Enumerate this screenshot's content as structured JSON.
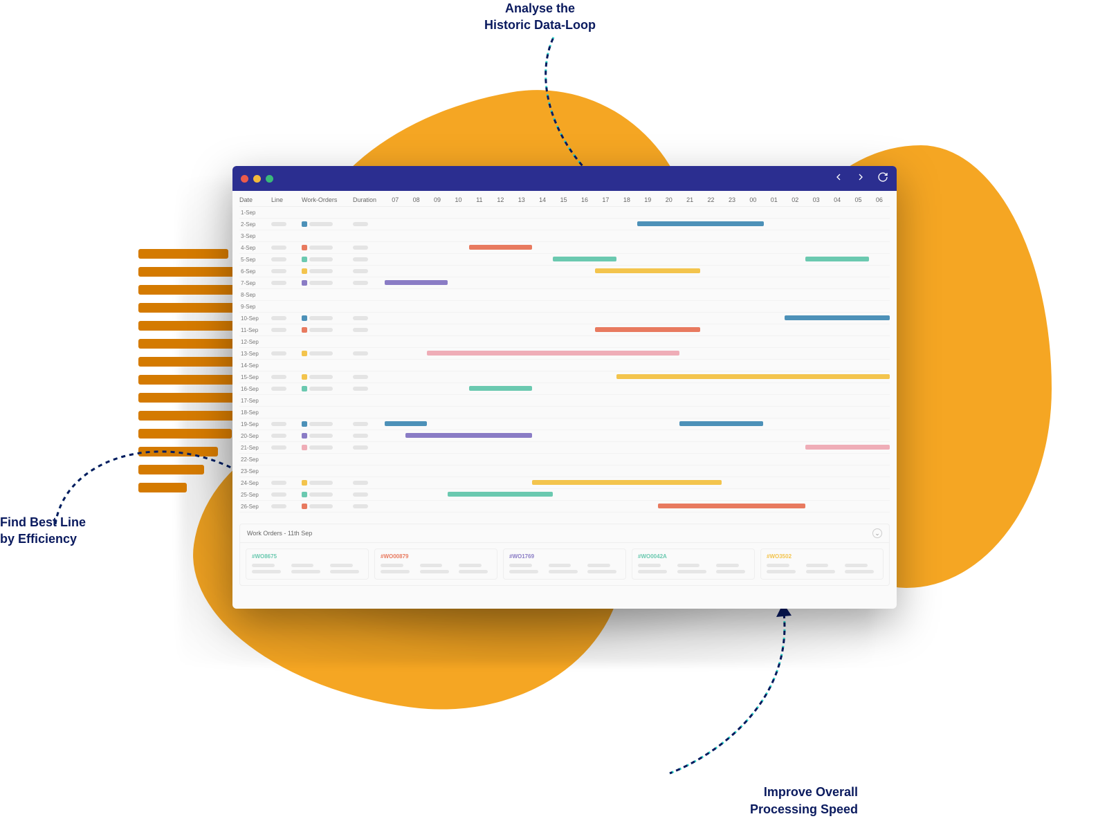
{
  "callouts": {
    "top_line1": "Analyse the",
    "top_line2": "Historic Data-Loop",
    "left_line1": "Find Best Line",
    "left_line2": "by Efficiency",
    "bottom_line1": "Improve Overall",
    "bottom_line2": "Processing Speed"
  },
  "columns": {
    "date": "Date",
    "line": "Line",
    "wo": "Work-Orders",
    "duration": "Duration"
  },
  "hours": [
    "07",
    "08",
    "09",
    "10",
    "11",
    "12",
    "13",
    "14",
    "15",
    "16",
    "17",
    "18",
    "19",
    "20",
    "21",
    "22",
    "23",
    "00",
    "01",
    "02",
    "03",
    "04",
    "05",
    "06"
  ],
  "rows": [
    {
      "date": "1-Sep",
      "line": false,
      "wo": false,
      "dur": false,
      "bars": []
    },
    {
      "date": "2-Sep",
      "line": true,
      "wo": "c-blue",
      "dur": true,
      "bars": [
        {
          "c": "c-blue",
          "start": 12,
          "span": 6
        }
      ]
    },
    {
      "date": "3-Sep",
      "line": false,
      "wo": false,
      "dur": false,
      "bars": []
    },
    {
      "date": "4-Sep",
      "line": true,
      "wo": "c-red",
      "dur": true,
      "bars": [
        {
          "c": "c-red",
          "start": 4,
          "span": 3
        }
      ]
    },
    {
      "date": "5-Sep",
      "line": true,
      "wo": "c-teal",
      "dur": true,
      "bars": [
        {
          "c": "c-teal",
          "start": 8,
          "span": 3
        },
        {
          "c": "c-teal",
          "start": 20,
          "span": 3
        }
      ]
    },
    {
      "date": "6-Sep",
      "line": true,
      "wo": "c-amber",
      "dur": true,
      "bars": [
        {
          "c": "c-amber",
          "start": 10,
          "span": 5
        }
      ]
    },
    {
      "date": "7-Sep",
      "line": true,
      "wo": "c-purple",
      "dur": true,
      "bars": [
        {
          "c": "c-purple",
          "start": 0,
          "span": 3
        }
      ]
    },
    {
      "date": "8-Sep",
      "line": false,
      "wo": false,
      "dur": false,
      "bars": []
    },
    {
      "date": "9-Sep",
      "line": false,
      "wo": false,
      "dur": false,
      "bars": []
    },
    {
      "date": "10-Sep",
      "line": true,
      "wo": "c-blue",
      "dur": true,
      "bars": [
        {
          "c": "c-blue",
          "start": 19,
          "span": 5
        }
      ]
    },
    {
      "date": "11-Sep",
      "line": true,
      "wo": "c-red",
      "dur": true,
      "bars": [
        {
          "c": "c-red",
          "start": 10,
          "span": 5
        }
      ]
    },
    {
      "date": "12-Sep",
      "line": false,
      "wo": false,
      "dur": false,
      "bars": []
    },
    {
      "date": "13-Sep",
      "line": true,
      "wo": "c-amber",
      "dur": true,
      "bars": [
        {
          "c": "c-pink",
          "start": 2,
          "span": 12
        }
      ]
    },
    {
      "date": "14-Sep",
      "line": false,
      "wo": false,
      "dur": false,
      "bars": []
    },
    {
      "date": "15-Sep",
      "line": true,
      "wo": "c-amber",
      "dur": true,
      "bars": [
        {
          "c": "c-amber",
          "start": 11,
          "span": 13
        }
      ]
    },
    {
      "date": "16-Sep",
      "line": true,
      "wo": "c-teal",
      "dur": true,
      "bars": [
        {
          "c": "c-teal",
          "start": 4,
          "span": 3
        }
      ]
    },
    {
      "date": "17-Sep",
      "line": false,
      "wo": false,
      "dur": false,
      "bars": []
    },
    {
      "date": "18-Sep",
      "line": false,
      "wo": false,
      "dur": false,
      "bars": []
    },
    {
      "date": "19-Sep",
      "line": true,
      "wo": "c-blue",
      "dur": true,
      "bars": [
        {
          "c": "c-blue",
          "start": 0,
          "span": 2
        },
        {
          "c": "c-blue",
          "start": 14,
          "span": 4
        }
      ]
    },
    {
      "date": "20-Sep",
      "line": true,
      "wo": "c-purple",
      "dur": true,
      "bars": [
        {
          "c": "c-purple",
          "start": 1,
          "span": 6
        }
      ]
    },
    {
      "date": "21-Sep",
      "line": true,
      "wo": "c-pink",
      "dur": true,
      "bars": [
        {
          "c": "c-pink",
          "start": 20,
          "span": 4
        }
      ]
    },
    {
      "date": "22-Sep",
      "line": false,
      "wo": false,
      "dur": false,
      "bars": []
    },
    {
      "date": "23-Sep",
      "line": false,
      "wo": false,
      "dur": false,
      "bars": []
    },
    {
      "date": "24-Sep",
      "line": true,
      "wo": "c-amber",
      "dur": true,
      "bars": [
        {
          "c": "c-amber",
          "start": 7,
          "span": 9
        }
      ]
    },
    {
      "date": "25-Sep",
      "line": true,
      "wo": "c-teal",
      "dur": true,
      "bars": [
        {
          "c": "c-teal",
          "start": 3,
          "span": 5
        }
      ]
    },
    {
      "date": "26-Sep",
      "line": true,
      "wo": "c-red",
      "dur": true,
      "bars": [
        {
          "c": "c-red",
          "start": 13,
          "span": 7
        }
      ]
    }
  ],
  "bottom": {
    "title": "Work Orders - 11th Sep",
    "cards": [
      {
        "id": "#WO8675",
        "color": "#6bc9b0"
      },
      {
        "id": "#WO00879",
        "color": "#e87a5f"
      },
      {
        "id": "#WO1769",
        "color": "#8a7cc5"
      },
      {
        "id": "#WO0042A",
        "color": "#6bc9b0"
      },
      {
        "id": "#WO3502",
        "color": "#f3c44d"
      }
    ]
  },
  "colors": {
    "titlebar": "#2b2e90",
    "accent": "#f5a623"
  }
}
